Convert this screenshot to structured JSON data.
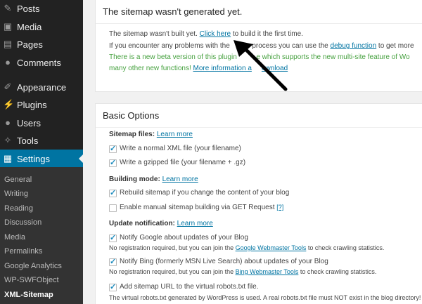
{
  "menu": [
    {
      "label": "Posts",
      "icon": "pin-icon"
    },
    {
      "label": "Media",
      "icon": "media-icon"
    },
    {
      "label": "Pages",
      "icon": "pages-icon"
    },
    {
      "label": "Comments",
      "icon": "comments-icon"
    },
    {
      "label": "Appearance",
      "icon": "appearance-icon"
    },
    {
      "label": "Plugins",
      "icon": "plugins-icon"
    },
    {
      "label": "Users",
      "icon": "users-icon"
    },
    {
      "label": "Tools",
      "icon": "tools-icon"
    },
    {
      "label": "Settings",
      "icon": "settings-icon"
    }
  ],
  "submenu": [
    "General",
    "Writing",
    "Reading",
    "Discussion",
    "Media",
    "Permalinks",
    "Google Analytics",
    "WP-SWFObject",
    "XML-Sitemap"
  ],
  "notice": {
    "title": "The sitemap wasn't generated yet.",
    "line1_pre": "The sitemap wasn't built yet.",
    "line1_link": "Click here",
    "line1_post": "to build it the first time.",
    "line2_pre": "If you encounter any problems with the",
    "line2_mid": "process you can use the",
    "line2_link": "debug function",
    "line2_post": "to get more",
    "line3": "There is a new beta version of this plugin",
    "line3b": "e which supports the new multi-site feature of Wo",
    "line4": "many other new functions!",
    "line4_link": "More information a",
    "line4_link2": "ownload"
  },
  "basic": {
    "title": "Basic Options",
    "files_label": "Sitemap files:",
    "learn_more": "Learn more",
    "opt1": "Write a normal XML file (your filename)",
    "opt2": "Write a gzipped file (your filename + .gz)",
    "building_label": "Building mode:",
    "opt3": "Rebuild sitemap if you change the content of your blog",
    "opt4": "Enable manual sitemap building via GET Request",
    "opt4_help": "[?]",
    "update_label": "Update notification:",
    "opt5": "Notify Google about updates of your Blog",
    "opt5_note_pre": "No registration required, but you can join the",
    "opt5_note_link": "Google Webmaster Tools",
    "opt5_note_post": "to check crawling statistics.",
    "opt6": "Notify Bing (formerly MSN Live Search) about updates of your Blog",
    "opt6_note_pre": "No registration required, but you can join the",
    "opt6_note_link": "Bing Webmaster Tools",
    "opt6_note_post": "to check crawling statistics.",
    "opt7": "Add sitemap URL to the virtual robots.txt file.",
    "opt7_note": "The virtual robots.txt generated by WordPress is used. A real robots.txt file must NOT exist in the blog directory!"
  }
}
